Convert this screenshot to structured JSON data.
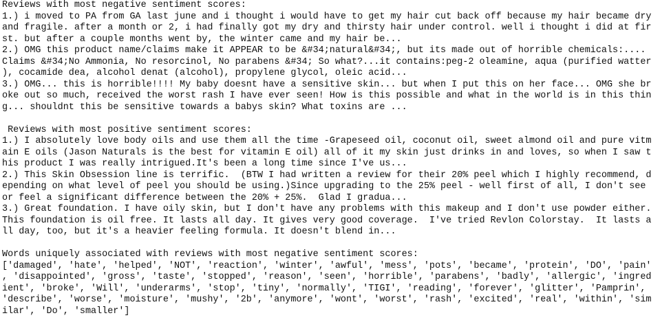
{
  "output": {
    "lines": [
      "Reviews with most negative sentiment scores:",
      "1.) i moved to PA from GA last june and i thought i would have to get my hair cut back off because my hair became dry",
      "and fragile. after a month or 2, i had finally got my dry and thirsty hair under control. well i thought i did at fir",
      "st. but after a couple months went by, the winter came and my hair be...",
      "2.) OMG this product name/claims make it APPEAR to be &#34;natural&#34;, but its made out of horrible chemicals:....",
      "Claims &#34;No Ammonia, No resorcinol, No parabens &#34; So what?...it contains:peg-2 oleamine, aqua (purified watter",
      "), cocamide dea, alcohol denat (alcohol), propylene glycol, oleic acid...",
      "3.) OMG... this is horrible!!!! My baby doesnt have a sensitive skin... but when I put this on her face... OMG she br",
      "oke out so much, received the worst rash I have ever seen! How is this possible and what in the world is in this thin",
      "g... shouldnt this be sensitive towards a babys skin? What toxins are ...",
      "",
      " Reviews with most positive sentiment scores:",
      "1.) I absolutely love body oils and use them all the time -Grapeseed oil, coconut oil, sweet almond oil and pure vitm",
      "ain E oils (Jason Naturals is the best for vitamin E oil) all of it my skin just drinks in and loves, so when I saw t",
      "his product I was really intrigued.It's been a long time since I've us...",
      "2.) This Skin Obsession line is terrific.  (BTW I had written a review for their 20% peel which I highly recommend, d",
      "epending on what level of peel you should be using.)Since upgrading to the 25% peel - well first of all, I don't see",
      "or feel a significant difference between the 20% + 25%.  Glad I gradua...",
      "3.) Great foundation. I have oily skin, but I don't have any problems with this makeup and I don't use powder either.",
      "This foundation is oil free. It lasts all day. It gives very good coverage.  I've tried Revlon Colorstay.  It lasts a",
      "ll day, too, but it's a heavier feeling formula. It doesn't blend in...",
      "",
      "Words uniquely associated with reviews with most negative sentiment scores:",
      "['damaged', 'hate', 'helped', 'NOT', 'reaction', 'winter', 'awful', 'mess', 'pots', 'became', 'protein', 'DO', 'pain'",
      ", 'disappointed', 'gross', 'taste', 'stopped', 'reason', 'seen', 'horrible', 'parabens', 'badly', 'allergic', 'ingred",
      "ient', 'broke', 'Will', 'underarms', 'stop', 'tiny', 'normally', 'TIGI', 'reading', 'forever', 'glitter', 'Pamprin',",
      "'describe', 'worse', 'moisture', 'mushy', '2b', 'anymore', 'wont', 'worst', 'rash', 'excited', 'real', 'within', 'sim",
      "ilar', 'Do', 'smaller']"
    ]
  }
}
